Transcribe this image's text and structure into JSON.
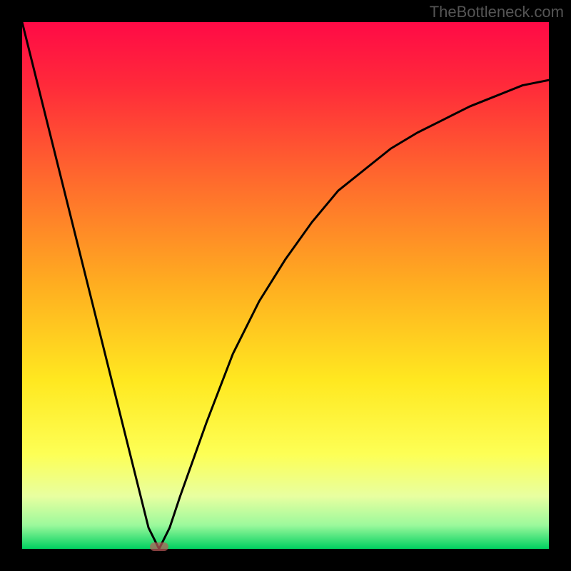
{
  "watermark": "TheBottleneck.com",
  "chart_data": {
    "type": "line",
    "title": "",
    "xlabel": "",
    "ylabel": "",
    "xlim": [
      0,
      100
    ],
    "ylim": [
      0,
      100
    ],
    "curves": [
      {
        "name": "bottleneck-curve",
        "x": [
          0,
          5,
          10,
          15,
          20,
          24,
          26,
          28,
          30,
          35,
          40,
          45,
          50,
          55,
          60,
          65,
          70,
          75,
          80,
          85,
          90,
          95,
          100
        ],
        "y": [
          100,
          80,
          60,
          40,
          20,
          4,
          0,
          4,
          10,
          24,
          37,
          47,
          55,
          62,
          68,
          72,
          76,
          79,
          81.5,
          84,
          86,
          88,
          89
        ]
      }
    ],
    "minimum_marker": {
      "x": 26,
      "y": 0
    },
    "gradient_stops": [
      {
        "offset": 0,
        "color": "#ff0a46"
      },
      {
        "offset": 0.12,
        "color": "#ff2a3a"
      },
      {
        "offset": 0.3,
        "color": "#ff6a2d"
      },
      {
        "offset": 0.5,
        "color": "#ffae20"
      },
      {
        "offset": 0.68,
        "color": "#ffe820"
      },
      {
        "offset": 0.82,
        "color": "#fdff55"
      },
      {
        "offset": 0.9,
        "color": "#e8ffa0"
      },
      {
        "offset": 0.955,
        "color": "#9cf99c"
      },
      {
        "offset": 1.0,
        "color": "#00d060"
      }
    ]
  }
}
